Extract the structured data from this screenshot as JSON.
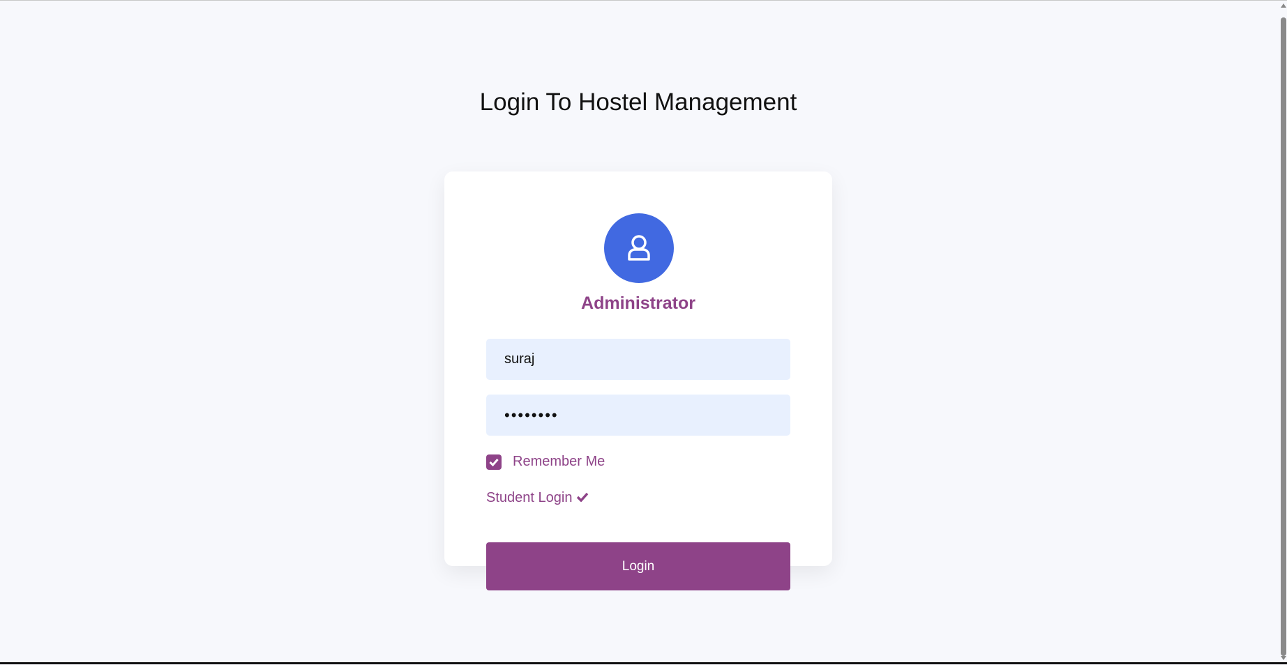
{
  "page": {
    "title": "Login To Hostel Management"
  },
  "login": {
    "role": "Administrator",
    "avatar_icon": "user-icon",
    "username": "suraj",
    "password": "password",
    "remember_label": "Remember Me",
    "remember_checked": true,
    "student_login": "Student Login",
    "student_login_icon": "check-icon",
    "submit": "Login"
  },
  "colors": {
    "accent": "#8e4388",
    "avatar": "#4169e1",
    "input_bg": "#e8f0fe",
    "background": "#f7f8fc"
  }
}
